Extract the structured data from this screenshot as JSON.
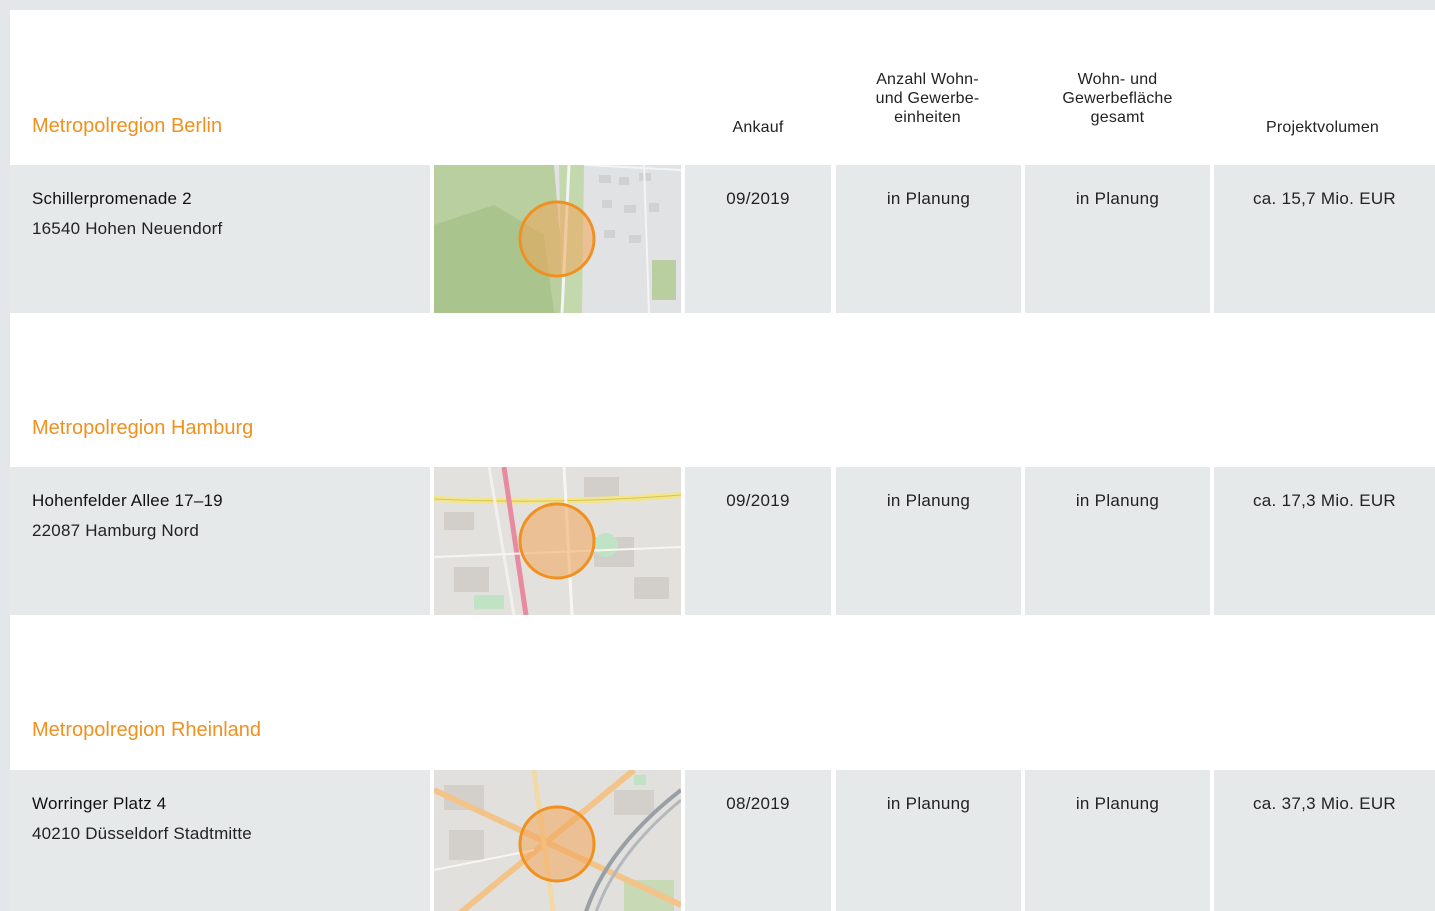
{
  "columns": {
    "ankauf": "Ankauf",
    "einheiten": "Anzahl Wohn-\nund Gewerbe-\neinheiten",
    "flaeche": "Wohn- und\nGewerbefläche\ngesamt",
    "volumen": "Projektvolumen"
  },
  "sections": [
    {
      "region": "Metropolregion Berlin",
      "street": "Schillerpromenade 2",
      "city": "16540 Hohen Neuendorf",
      "ankauf": "09/2019",
      "einheiten": "in Planung",
      "flaeche": "in Planung",
      "volumen": "ca. 15,7 Mio. EUR"
    },
    {
      "region": "Metropolregion Hamburg",
      "street": "Hohenfelder Allee 17–19",
      "city": "22087 Hamburg Nord",
      "ankauf": "09/2019",
      "einheiten": "in Planung",
      "flaeche": "in Planung",
      "volumen": "ca. 17,3 Mio. EUR"
    },
    {
      "region": "Metropolregion Rheinland",
      "street": "Worringer Platz 4",
      "city": "40210 Düsseldorf Stadtmitte",
      "ankauf": "08/2019",
      "einheiten": "in Planung",
      "flaeche": "in Planung",
      "volumen": "ca. 37,3 Mio. EUR"
    }
  ],
  "colors": {
    "accent": "#f0901e",
    "cell_bg": "#e6e9ea"
  }
}
